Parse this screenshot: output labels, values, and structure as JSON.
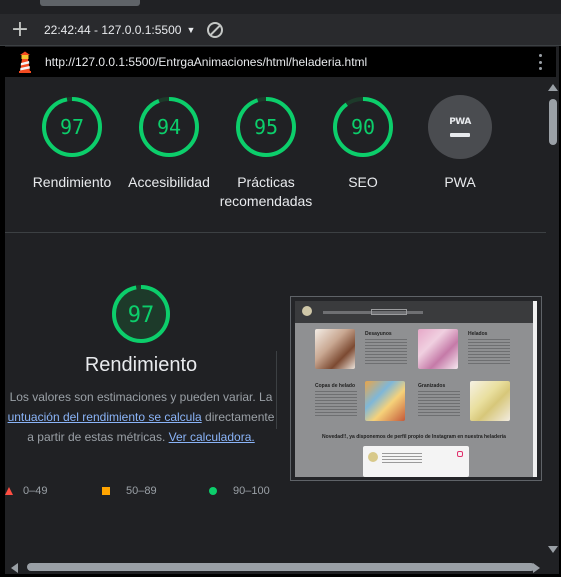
{
  "toolbar": {
    "add_icon": "plus-icon",
    "report_label": "22:42:44 - 127.0.0.1:5500",
    "clear_icon": "clear-icon"
  },
  "urlbar": {
    "url": "http://127.0.0.1:5500/EntrgaAnimaciones/html/heladeria.html"
  },
  "colors": {
    "pass": "#0cce6b",
    "average": "#ffa400",
    "fail": "#ff4e42",
    "pass_bg": "#1d3a2a"
  },
  "gauges": [
    {
      "score": 97,
      "label": "Rendimiento"
    },
    {
      "score": 94,
      "label": "Accesibilidad"
    },
    {
      "score": 95,
      "label": "Prácticas recomendadas"
    },
    {
      "score": 90,
      "label": "SEO"
    }
  ],
  "pwa": {
    "badge": "PWA",
    "label": "PWA"
  },
  "performance": {
    "score": 97,
    "title": "Rendimiento",
    "desc_line1": "Los valores son estimaciones y pueden variar. La",
    "desc_link1": "untuación del rendimiento se calcula",
    "desc_after_link1": " directamente",
    "desc_line3_pre": "a partir de estas métricas. ",
    "desc_link2": "Ver calculadora."
  },
  "legend": {
    "fail": "0–49",
    "average": "50–89",
    "pass": "90–100"
  },
  "thumbnail": {
    "sections": [
      "Desayunos",
      "Helados",
      "Copas de helado",
      "Granizados"
    ],
    "novedad": "Novedad!!, ya disponemos de perfil propio de Instagram en nuestra heladería"
  }
}
